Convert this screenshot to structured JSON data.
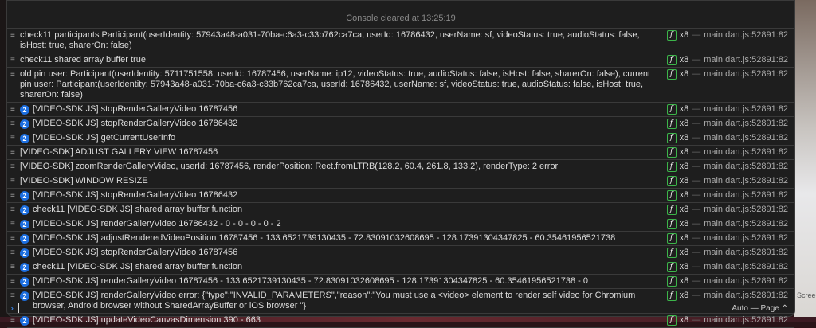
{
  "background": {
    "right_text": "Screen"
  },
  "console": {
    "cleared_text": "Console cleared at 13:25:19",
    "source": "main.dart.js:52891:82",
    "count": "x8",
    "dash": "—",
    "function_icon": "f",
    "rows": [
      {
        "badge": "",
        "text": "check11 participants Participant(userIdentity: 57943a48-a031-70ba-c6a3-c33b762ca7ca, userId: 16786432, userName: sf, videoStatus: true, audioStatus: false, isHost: true, sharerOn: false)"
      },
      {
        "badge": "",
        "text": "check11 shared array buffer true"
      },
      {
        "badge": "",
        "text": "old pin user: Participant(userIdentity: 5711751558, userId: 16787456, userName: ip12, videoStatus: true, audioStatus: false, isHost: false, sharerOn: false), current pin user: Participant(userIdentity: 57943a48-a031-70ba-c6a3-c33b762ca7ca, userId: 16786432, userName: sf, videoStatus: true, audioStatus: false, isHost: true, sharerOn: false)"
      },
      {
        "badge": "2",
        "text": "[VIDEO-SDK JS] stopRenderGalleryVideo 16787456"
      },
      {
        "badge": "2",
        "text": "[VIDEO-SDK JS] stopRenderGalleryVideo 16786432"
      },
      {
        "badge": "2",
        "text": "[VIDEO-SDK JS] getCurrentUserInfo"
      },
      {
        "badge": "",
        "text": "[VIDEO-SDK] ADJUST GALLERY VIEW 16787456"
      },
      {
        "badge": "",
        "text": "[VIDEO-SDK] zoomRenderGalleryVideo, userId: 16787456, renderPosition: Rect.fromLTRB(128.2, 60.4, 261.8, 133.2), renderType: 2 error"
      },
      {
        "badge": "",
        "text": "[VIDEO-SDK] WINDOW RESIZE"
      },
      {
        "badge": "2",
        "text": "[VIDEO-SDK JS] stopRenderGalleryVideo 16786432"
      },
      {
        "badge": "2",
        "text": "check11 [VIDEO-SDK JS] shared array buffer function"
      },
      {
        "badge": "2",
        "text": "[VIDEO-SDK JS] renderGalleryVideo 16786432 - 0 - 0 - 0 - 0 - 2"
      },
      {
        "badge": "2",
        "text": "[VIDEO-SDK JS] adjustRenderedVideoPosition 16787456 - 133.6521739130435 - 72.83091032608695 - 128.17391304347825 - 60.35461956521738"
      },
      {
        "badge": "2",
        "text": "[VIDEO-SDK JS] stopRenderGalleryVideo 16787456"
      },
      {
        "badge": "2",
        "text": "check11 [VIDEO-SDK JS] shared array buffer function"
      },
      {
        "badge": "2",
        "text": "[VIDEO-SDK JS] renderGalleryVideo 16787456 - 133.6521739130435 - 72.83091032608695 - 128.17391304347825 - 60.35461956521738 - 0"
      },
      {
        "badge": "2",
        "text": "[VIDEO-SDK JS] renderGalleryVideo error: {\"type\":\"INVALID_PARAMETERS\",\"reason\":\"You must use a <video> element to render self video for Chromium browser, Android browser without SharedArrayBuffer or iOS browser \"}"
      },
      {
        "badge": "2",
        "text": "[VIDEO-SDK JS] updateVideoCanvasDimension 390 - 663"
      }
    ],
    "prompt_value": "",
    "context_mode": "Auto — Page ⌃"
  }
}
